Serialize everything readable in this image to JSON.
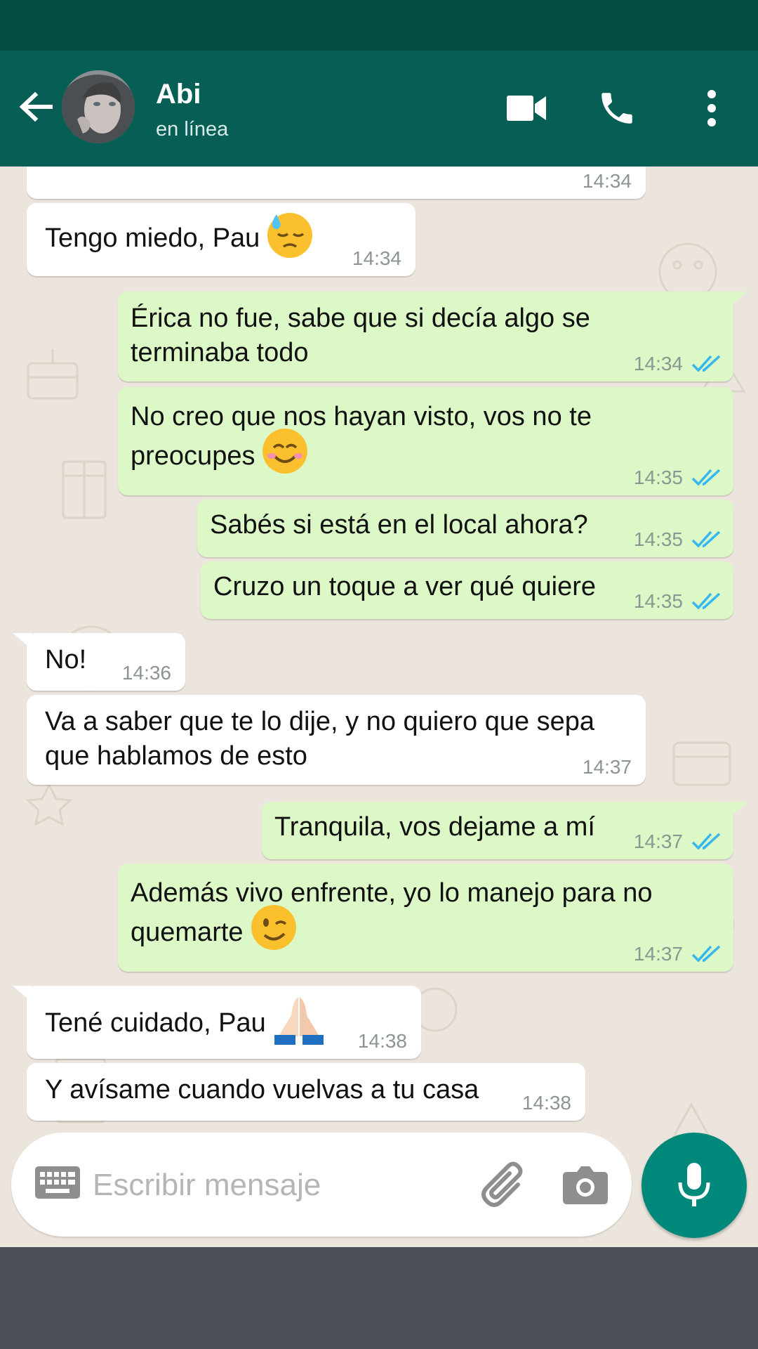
{
  "contact": {
    "name": "Abi",
    "status": "en línea"
  },
  "header_icons": [
    "back-arrow-icon",
    "video-call-icon",
    "phone-call-icon",
    "more-vert-icon"
  ],
  "messages": [
    {
      "dir": "in",
      "text": "",
      "time": "14:34"
    },
    {
      "dir": "in",
      "text": "Tengo miedo, Pau",
      "emoji": "downcast-face-with-sweat-emoji",
      "time": "14:34"
    },
    {
      "dir": "out",
      "text": "Érica no fue, sabe que si decía algo se\nterminaba todo",
      "time": "14:34",
      "read": true
    },
    {
      "dir": "out",
      "text": "No creo que nos hayan visto, vos no te\npreocupes",
      "emoji": "smiling-face-emoji",
      "time": "14:35",
      "read": true
    },
    {
      "dir": "out",
      "text": "Sabés si está en el local ahora?",
      "time": "14:35",
      "read": true
    },
    {
      "dir": "out",
      "text": "Cruzo un toque a ver qué quiere",
      "time": "14:35",
      "read": true
    },
    {
      "dir": "in",
      "text": "No!",
      "time": "14:36"
    },
    {
      "dir": "in",
      "text": "Va a saber que te lo dije, y no quiero que sepa\nque hablamos de esto",
      "time": "14:37"
    },
    {
      "dir": "out",
      "text": "Tranquila, vos dejame a mí",
      "time": "14:37",
      "read": true
    },
    {
      "dir": "out",
      "text": "Además vivo enfrente, yo lo manejo para no\nquemarte",
      "emoji": "winking-face-emoji",
      "time": "14:37",
      "read": true
    },
    {
      "dir": "in",
      "text": "Tené cuidado, Pau",
      "emoji": "folded-hands-emoji",
      "time": "14:38"
    },
    {
      "dir": "in",
      "text": "Y avísame cuando vuelvas a tu casa",
      "time": "14:38"
    }
  ],
  "composer": {
    "placeholder": "Escribir mensaje",
    "value": ""
  },
  "colors": {
    "header": "#075e54",
    "status_bar": "#054d44",
    "chat_background": "#ece5dd",
    "incoming_bubble": "#ffffff",
    "outgoing_bubble": "#dcf8c6",
    "read_ticks": "#34b7f1",
    "mic_button": "#00897b"
  }
}
